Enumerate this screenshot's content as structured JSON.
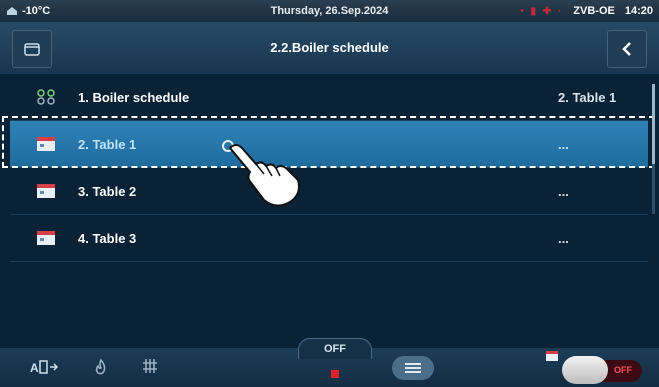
{
  "status_bar": {
    "temperature": "-10°C",
    "date": "Thursday, 26.Sep.2024",
    "device": "ZVB-OE",
    "time": "14:20"
  },
  "header": {
    "title": "2.2.Boiler schedule"
  },
  "rows": [
    {
      "label": "1.  Boiler schedule",
      "value": "2. Table 1",
      "icon": "schedule-dots-icon"
    },
    {
      "label": "2.  Table 1",
      "value": "...",
      "icon": "calendar-icon"
    },
    {
      "label": "3.  Table 2",
      "value": "...",
      "icon": "calendar-icon"
    },
    {
      "label": "4.  Table 3",
      "value": "...",
      "icon": "calendar-icon"
    }
  ],
  "bottom_bar": {
    "mode_label": "OFF",
    "toggle_label": "OFF"
  },
  "colors": {
    "selected_row": "#2f82b6",
    "led_red": "#e3222c"
  }
}
